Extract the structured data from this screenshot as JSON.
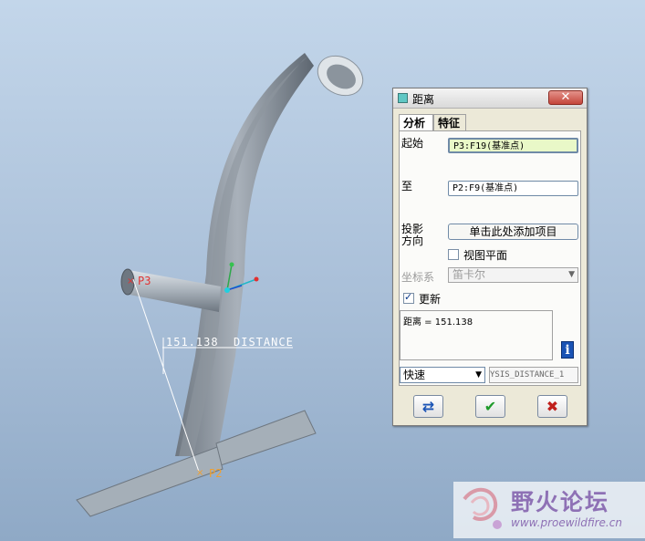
{
  "viewport": {
    "point_start": "P3",
    "point_end": "P2",
    "measurement_value": "151.138",
    "measurement_label": "DISTANCE"
  },
  "dialog": {
    "title": "距离",
    "tabs": [
      "分析",
      "特征"
    ],
    "from_label": "起始",
    "from_value": "P3:F19(基准点)",
    "to_label": "至",
    "to_value": "P2:F9(基准点)",
    "projection_label_1": "投影",
    "projection_label_2": "方向",
    "projection_button": "单击此处添加项目",
    "view_plane_label": "视图平面",
    "coord_label": "坐标系",
    "coord_value": "笛卡尔",
    "update_label": "更新",
    "update_checked": true,
    "result_text": "距离 = 151.138",
    "speed_value": "快速",
    "feature_name": "YSIS_DISTANCE_1"
  },
  "watermark": {
    "title": "野火论坛",
    "url": "www.proewildfire.cn"
  }
}
